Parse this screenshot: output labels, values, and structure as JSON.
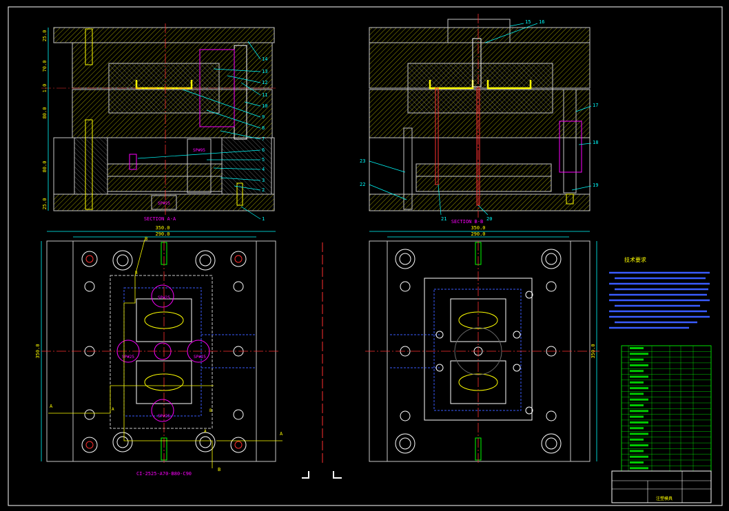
{
  "colors": {
    "background": "#000000",
    "frame": "#ffffff",
    "body": "#c8c8c8",
    "hatch": "#ffff00",
    "leader": "#00ffff",
    "centerline": "#ff3030",
    "dimension": "#00ffff",
    "label": "#ff00ff",
    "table": "#00ff00"
  },
  "sections": {
    "section_a_label": "SECTION A-A",
    "section_b_label": "SECTION B-B"
  },
  "dimensions": {
    "left_plan_outer": "350.0",
    "left_plan_inner": "290.0",
    "right_plan_outer": "350.0",
    "right_plan_inner": "290.0",
    "left_plan_height": "350.0",
    "right_plan_height": "350.0",
    "section_a_heights": [
      "25.0",
      "70.0",
      "1.0",
      "80.0",
      "80.0",
      "25.0"
    ]
  },
  "section_a_callouts": [
    "14",
    "13",
    "12",
    "11",
    "10",
    "9",
    "8",
    "7",
    "6",
    "5",
    "4",
    "3",
    "2",
    "1"
  ],
  "section_b_callouts": {
    "top": [
      "15",
      "16"
    ],
    "right": [
      "17",
      "18",
      "19"
    ],
    "left": [
      "23",
      "22"
    ],
    "bottom": [
      "21",
      "20"
    ]
  },
  "plan_labels": {
    "left_gate_labels": [
      "SP#25",
      "SP#25",
      "SP#25"
    ],
    "left_bottom_label": "SP#25",
    "section_marks": [
      "A",
      "A",
      "B",
      "B"
    ],
    "cutting_plane_letters": [
      "B",
      "A",
      "A",
      "B"
    ],
    "section_a_tags": [
      "SP#95",
      "SP#25"
    ]
  },
  "mold_base_code": "CI-2525-A70-B80-C90",
  "technical_requirements": {
    "title": "技术要求"
  },
  "title_block": {
    "designation": "注塑模具"
  }
}
